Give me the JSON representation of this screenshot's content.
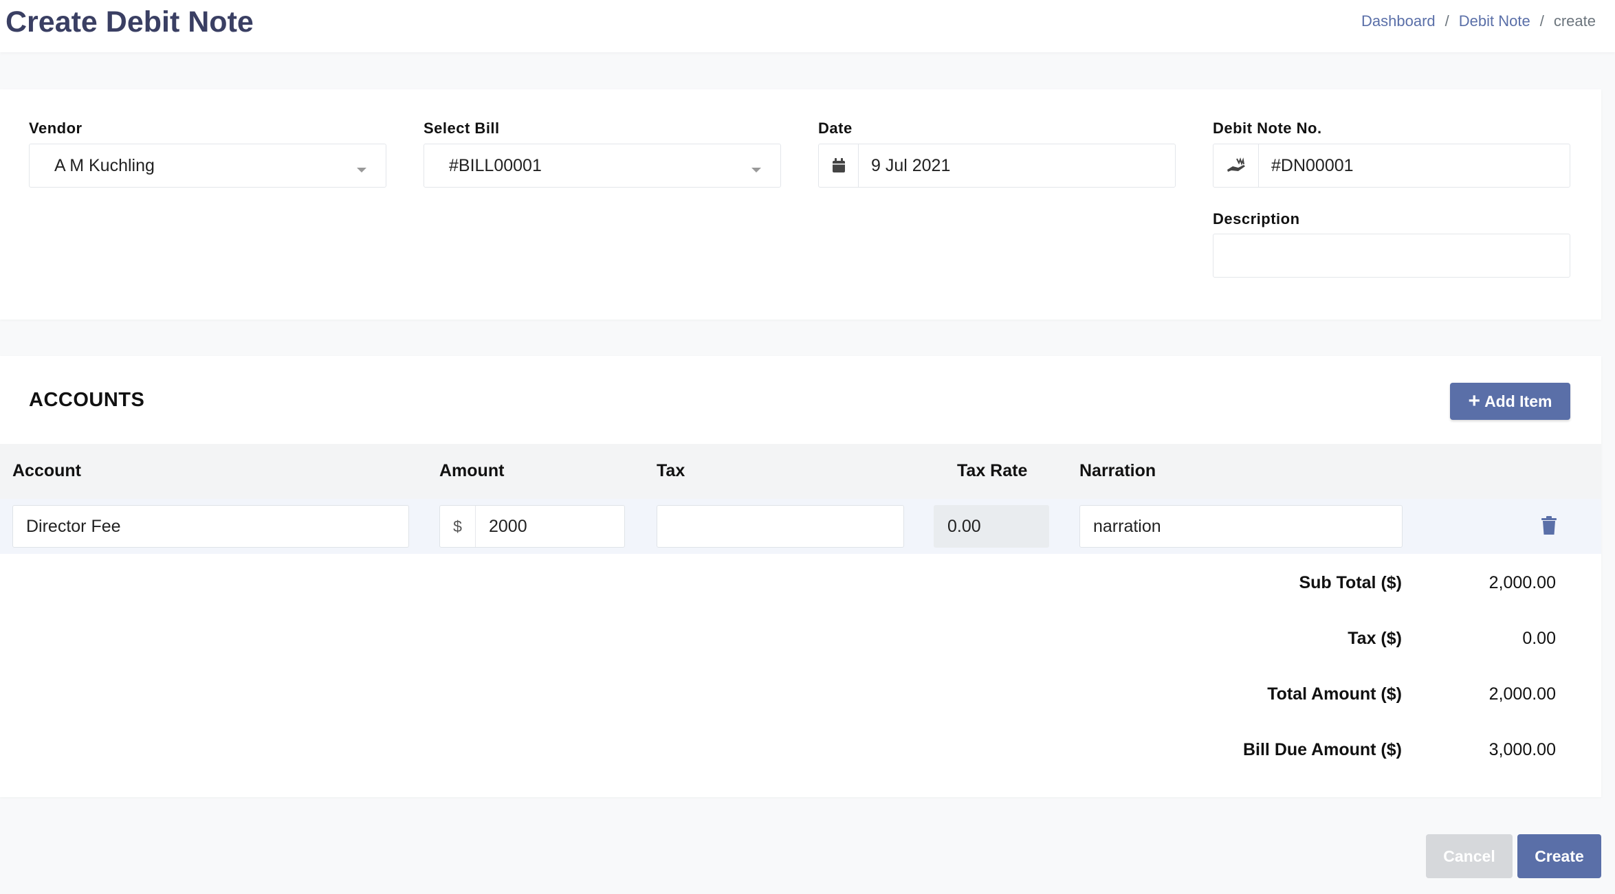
{
  "page": {
    "title": "Create Debit Note"
  },
  "breadcrumb": {
    "dashboard": "Dashboard",
    "separator": "/",
    "debit_note": "Debit Note",
    "current": "create"
  },
  "form": {
    "vendor_label": "Vendor",
    "vendor_value": "A M Kuchling",
    "bill_label": "Select Bill",
    "bill_value": "#BILL00001",
    "date_label": "Date",
    "date_value": "9 Jul 2021",
    "debit_no_label": "Debit Note No.",
    "debit_no_value": "#DN00001",
    "description_label": "Description",
    "description_value": ""
  },
  "accounts": {
    "title": "ACCOUNTS",
    "add_item_label": "Add Item",
    "columns": [
      "Account",
      "Amount",
      "Tax",
      "Tax Rate",
      "Narration"
    ],
    "rows": [
      {
        "account": "Director Fee",
        "currency_symbol": "$",
        "amount": "2000",
        "tax": "",
        "tax_rate": "0.00",
        "narration": "narration"
      }
    ]
  },
  "summary": {
    "sub_total_label": "Sub Total ($)",
    "sub_total_value": "2,000.00",
    "tax_label": "Tax ($)",
    "tax_value": "0.00",
    "total_label": "Total Amount ($)",
    "total_value": "2,000.00",
    "bill_due_label": "Bill Due Amount ($)",
    "bill_due_value": "3,000.00"
  },
  "actions": {
    "cancel_label": "Cancel",
    "create_label": "Create"
  },
  "colors": {
    "primary": "#5a6fa8",
    "title": "#3a3f63",
    "disabled": "#d6d8db"
  },
  "icons": {
    "date": "calendar-icon",
    "debit_no": "hand-coin-icon",
    "delete": "trash-icon",
    "add": "plus-icon"
  }
}
